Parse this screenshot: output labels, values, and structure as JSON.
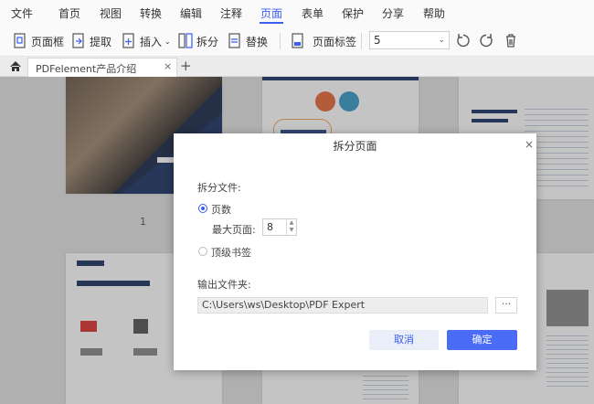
{
  "menu": {
    "items": [
      "文件",
      "首页",
      "视图",
      "转换",
      "编辑",
      "注释",
      "页面",
      "表单",
      "保护",
      "分享",
      "帮助"
    ],
    "active_index": 6
  },
  "toolbar": {
    "page_box": "页面框",
    "extract": "提取",
    "insert": "插入",
    "split": "拆分",
    "replace": "替换",
    "page_labels": "页面标签",
    "zoom_value": "5"
  },
  "tabs": {
    "doc_title": "PDFelement产品介绍",
    "close": "×",
    "add": "+"
  },
  "canvas": {
    "page_number": "1"
  },
  "dialog": {
    "title": "拆分页面",
    "close": "×",
    "split_file_label": "拆分文件:",
    "option_pages": "页数",
    "max_pages_label": "最大页面:",
    "max_pages_value": "8",
    "option_bookmarks": "顶级书签",
    "output_folder_label": "输出文件夹:",
    "output_path": "C:\\Users\\ws\\Desktop\\PDF Expert",
    "browse": "···",
    "cancel": "取消",
    "ok": "确定"
  },
  "colors": {
    "accent": "#3a5ef0",
    "primary_button": "#4a6cf7"
  },
  "icons": [
    "home-icon",
    "page-box-icon",
    "extract-icon",
    "insert-icon",
    "split-icon",
    "replace-icon",
    "page-labels-icon",
    "rotate-left-icon",
    "rotate-right-icon",
    "delete-icon"
  ]
}
